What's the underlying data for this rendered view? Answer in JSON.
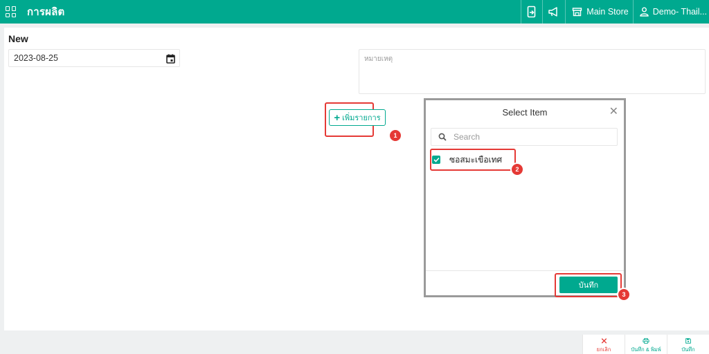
{
  "header": {
    "app_title": "การผลิต",
    "store": "Main Store",
    "user": "Demo- Thail..."
  },
  "form": {
    "title": "New",
    "date": "2023-08-25",
    "notes_placeholder": "หมายเหตุ",
    "add_item_label": "เพิ่มรายการ"
  },
  "modal": {
    "title": "Select Item",
    "search_placeholder": "Search",
    "items": [
      {
        "label": "ซอสมะเขือเทศ",
        "checked": true
      }
    ],
    "save_label": "บันทึก"
  },
  "steps": [
    "1",
    "2",
    "3"
  ],
  "footer": {
    "cancel_label": "ยกเลิก",
    "save_print_label": "บันทึก & พิมพ์",
    "save_label": "บันทึก"
  },
  "colors": {
    "accent": "#00a98f",
    "highlight": "#e53935"
  }
}
